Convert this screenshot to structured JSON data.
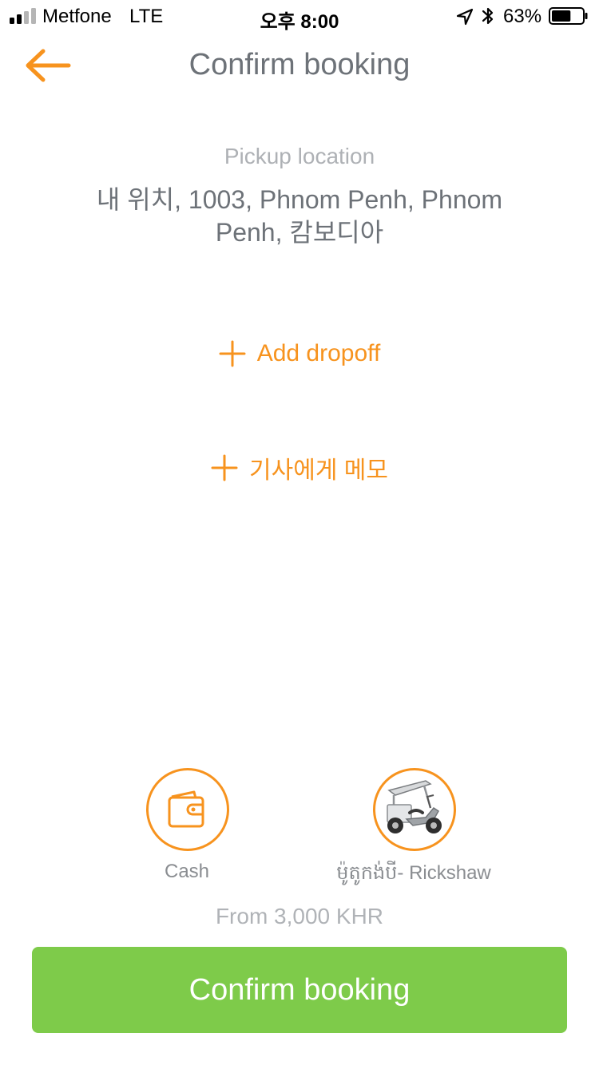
{
  "status_bar": {
    "carrier": "Metfone",
    "network": "LTE",
    "time": "오후 8:00",
    "battery_percent": "63%",
    "battery_level": 0.63,
    "signal_bars_filled": 2,
    "signal_bars_total": 4
  },
  "header": {
    "title": "Confirm booking",
    "back_icon": "arrow-left-icon"
  },
  "pickup": {
    "label": "Pickup location",
    "address": "내 위치, 1003, Phnom Penh, Phnom Penh, 캄보디아"
  },
  "actions": {
    "add_dropoff": "Add dropoff",
    "driver_memo": "기사에게 메모"
  },
  "payment": {
    "label": "Cash",
    "icon": "wallet-icon"
  },
  "vehicle": {
    "label": "ម៉ូតូកង់បី- Rickshaw",
    "icon": "rickshaw-icon"
  },
  "fare": {
    "text": "From 3,000 KHR"
  },
  "confirm_button": {
    "label": "Confirm booking"
  },
  "colors": {
    "accent_orange": "#f7931e",
    "confirm_green": "#7ecb4a",
    "title_gray": "#6d7278",
    "muted_gray": "#aeb1b5"
  }
}
